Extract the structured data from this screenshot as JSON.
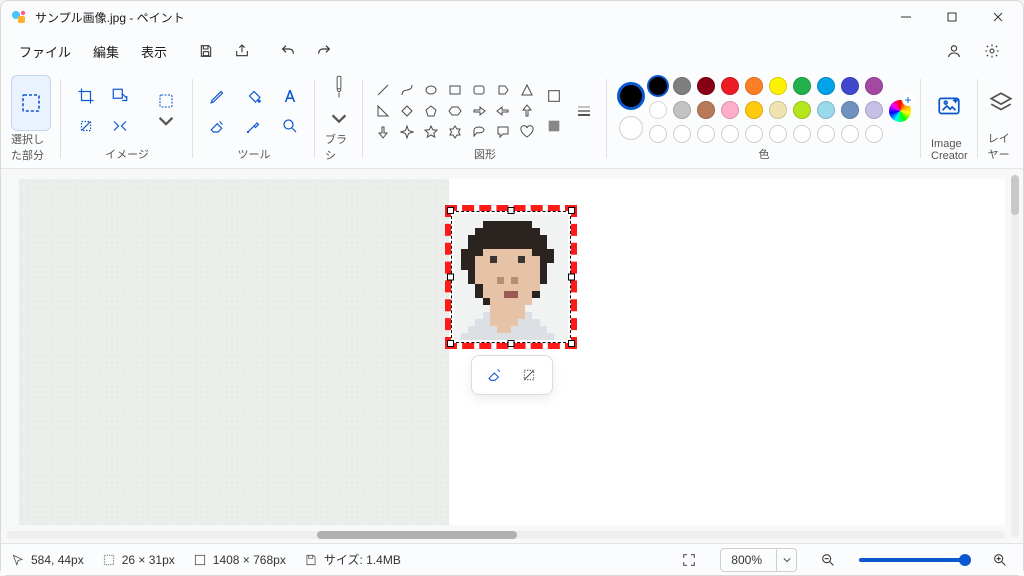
{
  "titlebar": {
    "title": "サンプル画像.jpg - ペイント"
  },
  "menu": {
    "file": "ファイル",
    "edit": "編集",
    "view": "表示"
  },
  "ribbon": {
    "selection_label": "選択した部分",
    "image_label": "イメージ",
    "tools_label": "ツール",
    "brush_label": "ブラシ",
    "shapes_label": "図形",
    "colors_label": "色",
    "image_creator_label": "Image Creator",
    "layers_label": "レイヤー"
  },
  "colors": {
    "current": "#000000",
    "row1": [
      "#000000",
      "#7f7f7f",
      "#880015",
      "#ed1c24",
      "#ff7f27",
      "#fff200",
      "#22b14c",
      "#00a2e8",
      "#3f48cc",
      "#a349a4"
    ],
    "row2": [
      "#ffffff",
      "#c3c3c3",
      "#b97a57",
      "#ffaec9",
      "#ffc90e",
      "#efe4b0",
      "#b5e61d",
      "#99d9ea",
      "#7092be",
      "#c8bfe7"
    ]
  },
  "status": {
    "cursor": "584, 44px",
    "selection": "26 × 31px",
    "canvas": "1408 × 768px",
    "size_label": "サイズ: 1.4MB",
    "zoom": "800%"
  },
  "portrait_pixels": [
    "................",
    "....aaaaaaa.....",
    "...aaaaaaaaa....",
    "..aaaaaaaaaaa...",
    "..aaaaaaaaaaa...",
    ".aaabbbbbbbaaa..",
    ".aabbcbbbcbbaa..",
    ".aabbbbbbbbba...",
    "..abbbbbbbbba...",
    "..abbbdbdbbba...",
    "...abbbbbbbb....",
    "...abbbeebba....",
    "....abbbbbb.....",
    ".....bbbbb......",
    "....fbbbbbf.....",
    "...ffbbbbfff....",
    "..ffffbbfffff...",
    ".fffffffffffff.."
  ],
  "portrait_palette": {
    ".": "#f1f2f2",
    "a": "#2a231f",
    "b": "#e6c2a7",
    "c": "#3a3532",
    "d": "#b88d72",
    "e": "#9c5a55",
    "f": "#dcdfe3"
  }
}
